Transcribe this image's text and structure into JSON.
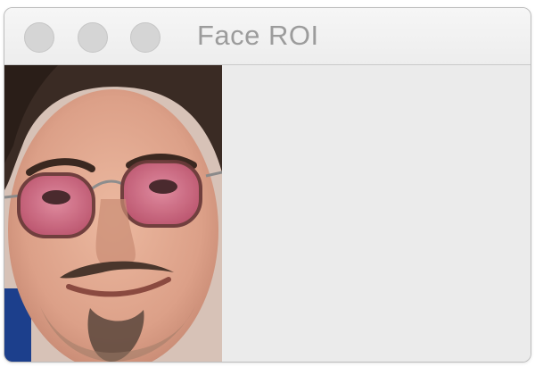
{
  "window": {
    "title": "Face ROI"
  },
  "traffic_lights": [
    {
      "name": "close-button",
      "color": "#d5d5d5"
    },
    {
      "name": "minimize-button",
      "color": "#d5d5d5"
    },
    {
      "name": "zoom-button",
      "color": "#d5d5d5"
    }
  ],
  "image": {
    "icon": "face-photo",
    "colors": {
      "skin": "#e2a98f",
      "hair": "#3a2b24",
      "lens": "#c9607a",
      "background": "#1c3f8c",
      "canvas": "#ebebeb"
    }
  }
}
